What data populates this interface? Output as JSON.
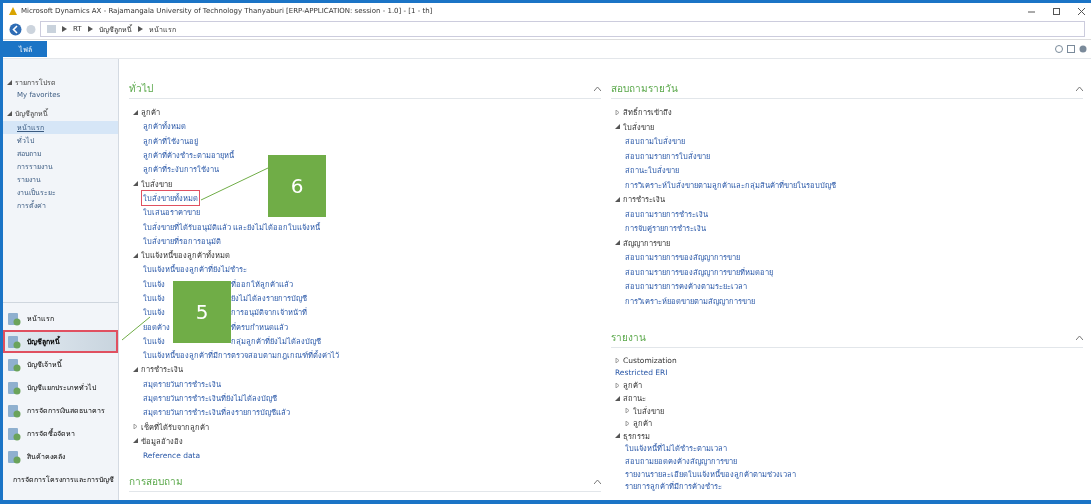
{
  "window": {
    "title": "Microsoft Dynamics AX - Rajamangala University of Technology Thanyaburi [ERP-APPLICATION: session - 1.0] - [1 - th]"
  },
  "breadcrumb": [
    "RT",
    "บัญชีลูกหนี้",
    "หน้าแรก"
  ],
  "file_tab": {
    "label": "ไฟล์"
  },
  "nav": {
    "sections": [
      {
        "label": "รายการโปรด",
        "expanded": true,
        "children": [
          {
            "label": "My favorites",
            "selected": false
          }
        ]
      },
      {
        "label": "บัญชีลูกหนี้",
        "expanded": true,
        "children": [
          {
            "label": "หน้าแรก",
            "selected": true
          },
          {
            "label": "ทั่วไป",
            "selected": false
          },
          {
            "label": "สอบถาม",
            "selected": false
          },
          {
            "label": "การรายงาน",
            "selected": false
          },
          {
            "label": "รายงาน",
            "selected": false
          },
          {
            "label": "งานเป็นระยะ",
            "selected": false
          },
          {
            "label": "การตั้งค่า",
            "selected": false
          }
        ]
      }
    ]
  },
  "modules": [
    {
      "label": "หน้าแรก",
      "selected": false,
      "annotated": false
    },
    {
      "label": "บัญชีลูกหนี้",
      "selected": true,
      "annotated": true
    },
    {
      "label": "บัญชีเจ้าหนี้",
      "selected": false,
      "annotated": false
    },
    {
      "label": "บัญชีแยกประเภททั่วไป",
      "selected": false,
      "annotated": false
    },
    {
      "label": "การจัดการเงินสดธนาคาร",
      "selected": false,
      "annotated": false
    },
    {
      "label": "การจัดซื้อจัดหา",
      "selected": false,
      "annotated": false
    },
    {
      "label": "สินค้าคงคลัง",
      "selected": false,
      "annotated": false
    },
    {
      "label": "การจัดการโครงการและการบัญชี",
      "selected": false,
      "annotated": false
    }
  ],
  "columns": [
    {
      "sections": [
        {
          "title": "ทั่วไป",
          "items": [
            {
              "label": "ลูกค้า",
              "expanded": true,
              "children": [
                {
                  "label": "ลูกค้าทั้งหมด"
                },
                {
                  "label": "ลูกค้าที่ใช้งานอยู่"
                },
                {
                  "label": "ลูกค้าที่ค้างชำระตามอายุหนี้"
                },
                {
                  "label": "ลูกค้าที่ระงับการใช้งาน"
                }
              ]
            },
            {
              "label": "ใบสั่งขาย",
              "expanded": true,
              "children": [
                {
                  "label": "ใบสั่งขายทั้งหมด",
                  "annotated": true
                },
                {
                  "label": "ใบเสนอราคาขาย"
                },
                {
                  "label": "ใบสั่งขายที่ได้รับอนุมัติแล้ว และยังไม่ได้ออกใบแจ้งหนี้"
                },
                {
                  "label": "ใบสั่งขายที่รอการอนุมัติ"
                }
              ]
            },
            {
              "label": "ใบแจ้งหนี้ของลูกค้าทั้งหมด",
              "expanded": true,
              "callout": {
                "label": "5"
              },
              "children": [
                {
                  "label": "ใบแจ้งหนี้ของลูกค้าที่ยังไม่ชำระ"
                },
                {
                  "label": "ใบแจ้ง",
                  "tail": "ที่ออกให้ลูกค้าแล้ว"
                },
                {
                  "label": "ใบแจ้ง",
                  "tail": "ยังไม่ได้ลงรายการบัญชี"
                },
                {
                  "label": "ใบแจ้ง",
                  "tail": "การอนุมัติจากเจ้าหน้าที่"
                },
                {
                  "label": "ยอดค้าง",
                  "tail": "ที่ครบกำหนดแล้ว"
                },
                {
                  "label": "ใบแจ้ง",
                  "tail": "กลุ่มลูกค้าที่ยังไม่ได้ลงบัญชี"
                },
                {
                  "label": "ใบแจ้งหนี้ของลูกค้าที่มีการตรวจสอบตามกฎเกณฑ์ที่ตั้งค่าไว้"
                }
              ]
            },
            {
              "label": "การชำระเงิน",
              "expanded": true,
              "children": [
                {
                  "label": "สมุดรายวันการชำระเงิน"
                },
                {
                  "label": "สมุดรายวันการชำระเงินที่ยังไม่ได้ลงบัญชี"
                },
                {
                  "label": "สมุดรายวันการชำระเงินที่ลงรายการบัญชีแล้ว"
                }
              ]
            },
            {
              "label": "เช็คที่ได้รับจากลูกค้า",
              "expanded": false
            },
            {
              "label": "ข้อมูลอ้างอิง",
              "expanded": true,
              "children": [
                {
                  "label": "Reference data"
                }
              ]
            }
          ]
        },
        {
          "title": "การสอบถาม"
        }
      ]
    },
    {
      "sections": [
        {
          "title": "สอบถามรายวัน",
          "items": [
            {
              "label": "สิทธิ์การเข้าถึง",
              "expanded": false
            },
            {
              "label": "ใบสั่งขาย",
              "expanded": true,
              "children": [
                {
                  "label": "สอบถามใบสั่งขาย"
                },
                {
                  "label": "สอบถามรายการใบสั่งขาย"
                },
                {
                  "label": "สถานะใบสั่งขาย"
                },
                {
                  "label": "การวิเคราะห์ใบสั่งขายตามลูกค้าและกลุ่มสินค้าที่ขายในรอบบัญชี"
                }
              ]
            },
            {
              "label": "การชำระเงิน",
              "expanded": true,
              "children": [
                {
                  "label": "สอบถามรายการชำระเงิน"
                },
                {
                  "label": "การจับคู่รายการชำระเงิน"
                }
              ]
            },
            {
              "label": "สัญญาการขาย",
              "expanded": true,
              "children": [
                {
                  "label": "สอบถามรายการของสัญญาการขาย"
                },
                {
                  "label": "สอบถามรายการของสัญญาการขายที่หมดอายุ"
                },
                {
                  "label": "สอบถามรายการคงค้างตามระยะเวลา"
                },
                {
                  "label": "การวิเคราะห์ยอดขายตามสัญญาการขาย"
                }
              ]
            }
          ]
        },
        {
          "title": "รายงาน",
          "items": [
            {
              "label": "Customization",
              "expanded": false
            },
            {
              "label": "Restricted ERI"
            },
            {
              "label": "ลูกค้า",
              "expanded": false
            },
            {
              "label": "สถานะ",
              "expanded": true,
              "children": [
                {
                  "label": "ใบสั่งขาย",
                  "expanded": false
                },
                {
                  "label": "ลูกค้า",
                  "expanded": false
                }
              ]
            },
            {
              "label": "ธุรกรรม",
              "expanded": true,
              "children": [
                {
                  "label": "ใบแจ้งหนี้ที่ไม่ได้ชำระตามเวลา"
                },
                {
                  "label": "สอบถามยอดคงค้างสัญญาการขาย"
                },
                {
                  "label": "รายงานรายละเอียดใบแจ้งหนี้ของลูกค้าตามช่วงเวลา"
                },
                {
                  "label": "รายการลูกค้าที่มีการค้างชำระ"
                }
              ]
            }
          ]
        }
      ]
    }
  ],
  "callouts": [
    {
      "label": "6"
    }
  ]
}
